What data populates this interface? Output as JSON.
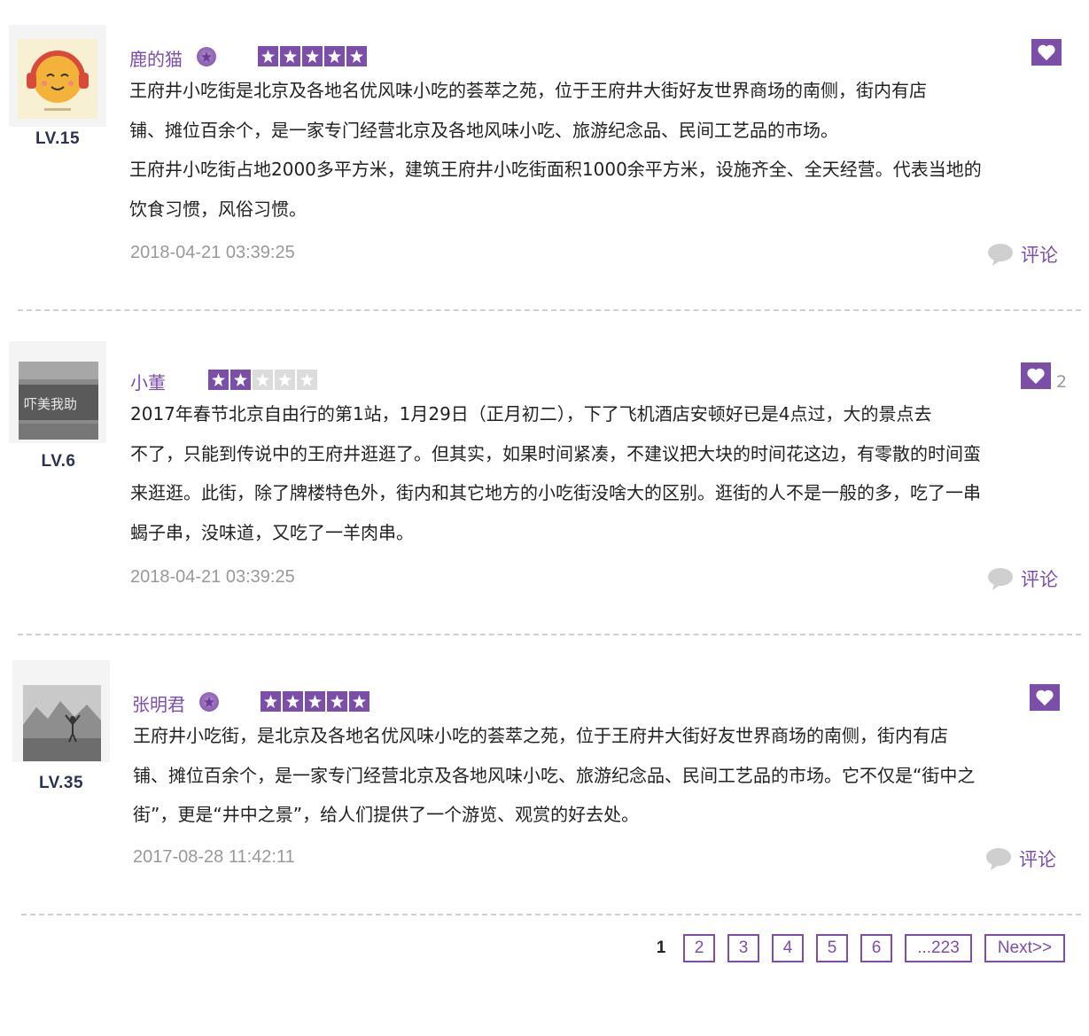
{
  "reviews": [
    {
      "username": "鹿的猫",
      "level": "LV.15",
      "vip": true,
      "rating": 5,
      "likes": "",
      "paragraphs": [
        "王府井小吃街是北京及各地名优风味小吃的荟萃之苑，位于王府井大街好友世界商场的南侧，街内有店",
        "铺、摊位百余个，是一家专门经营北京及各地风味小吃、旅游纪念品、民间工艺品的市场。",
        "王府井小吃街占地2000多平方米，建筑王府井小吃街面积1000余平方米，设施齐全、全天经营。代表当地的",
        "饮食习惯，风俗习惯。"
      ],
      "timestamp": "2018-04-21 03:39:25",
      "comment_label": "评论"
    },
    {
      "username": "小董",
      "level": "LV.6",
      "vip": false,
      "rating": 2,
      "likes": "2",
      "paragraphs": [
        "2017年春节北京自由行的第1站，1月29日（正月初二），下了飞机酒店安顿好已是4点过，大的景点去",
        "不了，只能到传说中的王府井逛逛了。但其实，如果时间紧凑，不建议把大块的时间花这边，有零散的时间蛮",
        "来逛逛。此街，除了牌楼特色外，街内和其它地方的小吃街没啥大的区别。逛街的人不是一般的多，吃了一串",
        "蝎子串，没味道，又吃了一羊肉串。"
      ],
      "timestamp": "2018-04-21 03:39:25",
      "comment_label": "评论"
    },
    {
      "username": "张明君",
      "level": "LV.35",
      "vip": true,
      "rating": 5,
      "likes": "",
      "paragraphs": [
        "王府井小吃街，是北京及各地名优风味小吃的荟萃之苑，位于王府井大街好友世界商场的南侧，街内有店",
        "铺、摊位百余个，是一家专门经营北京及各地风味小吃、旅游纪念品、民间工艺品的市场。它不仅是“街中之",
        "街”，更是“井中之景”，给人们提供了一个游览、观赏的好去处。"
      ],
      "timestamp": "2017-08-28 11:42:11",
      "comment_label": "评论"
    }
  ],
  "pagination": {
    "current": "1",
    "pages": [
      "2",
      "3",
      "4",
      "5",
      "6",
      "...223"
    ],
    "next_label": "Next>>"
  },
  "colors": {
    "accent": "#7b4fa8",
    "muted": "#999999",
    "divider": "#d0d0d0"
  },
  "icons": {
    "like": "heart-icon",
    "comment": "speech-bubble-icon",
    "vip": "vip-badge-icon",
    "star": "star-icon"
  }
}
